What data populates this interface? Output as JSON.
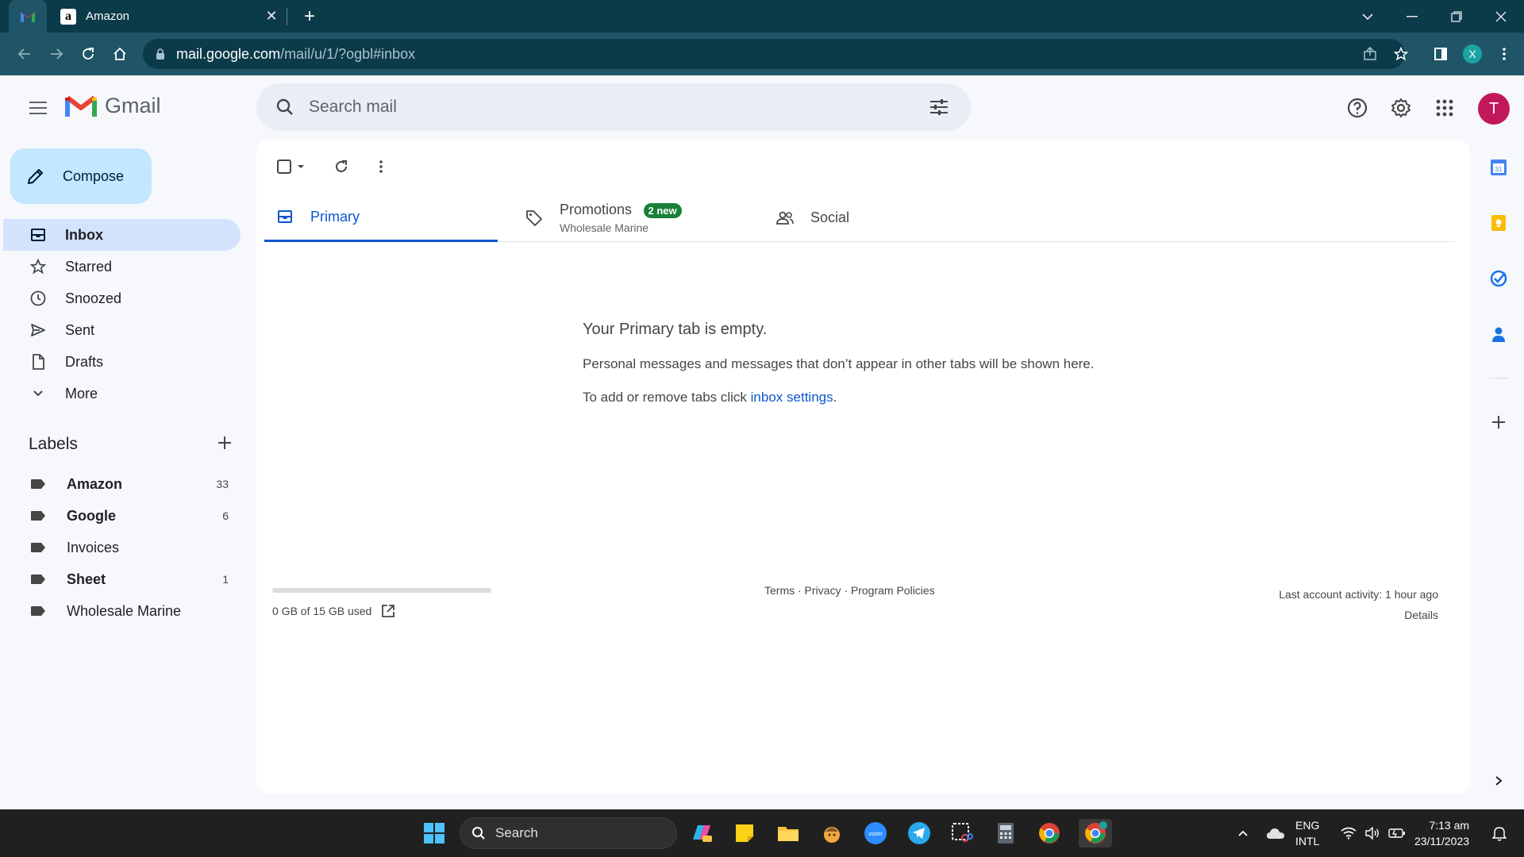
{
  "browser": {
    "tab_title": "Amazon",
    "url_host": "mail.google.com",
    "url_path": "/mail/u/1/?ogbl#inbox",
    "profile_initial": "X"
  },
  "gmail": {
    "product_name": "Gmail",
    "search_placeholder": "Search mail",
    "avatar_initial": "T",
    "compose_label": "Compose",
    "nav": [
      {
        "label": "Inbox",
        "icon": "inbox-icon"
      },
      {
        "label": "Starred",
        "icon": "star-icon"
      },
      {
        "label": "Snoozed",
        "icon": "clock-icon"
      },
      {
        "label": "Sent",
        "icon": "send-icon"
      },
      {
        "label": "Drafts",
        "icon": "draft-icon"
      },
      {
        "label": "More",
        "icon": "chevron-down-icon"
      }
    ],
    "labels_heading": "Labels",
    "labels": [
      {
        "name": "Amazon",
        "count": "33",
        "bold": true
      },
      {
        "name": "Google",
        "count": "6",
        "bold": true
      },
      {
        "name": "Invoices",
        "count": "",
        "bold": false
      },
      {
        "name": "Sheet",
        "count": "1",
        "bold": true
      },
      {
        "name": "Wholesale Marine",
        "count": "",
        "bold": false
      }
    ],
    "tabs": {
      "primary": "Primary",
      "promotions": "Promotions",
      "promotions_badge": "2 new",
      "promotions_sub": "Wholesale Marine",
      "social": "Social"
    },
    "empty": {
      "heading": "Your Primary tab is empty.",
      "line1": "Personal messages and messages that don’t appear in other tabs will be shown here.",
      "line2_prefix": "To add or remove tabs click ",
      "line2_link": "inbox settings",
      "line2_suffix": "."
    },
    "footer": {
      "storage": "0 GB of 15 GB used",
      "links": "Terms · Privacy · Program Policies",
      "activity": "Last account activity: 1 hour ago",
      "details": "Details"
    }
  },
  "taskbar": {
    "search_label": "Search",
    "lang1": "ENG",
    "lang2": "INTL",
    "time": "7:13 am",
    "date": "23/11/2023"
  },
  "colors": {
    "browser_frame": "#0b3a49",
    "browser_toolbar": "#1f5566",
    "compose_bg": "#c2e7ff",
    "nav_active_bg": "#d3e3fd",
    "accent_blue": "#0b57d0",
    "promo_green": "#188038",
    "avatar": "#c2185b"
  }
}
